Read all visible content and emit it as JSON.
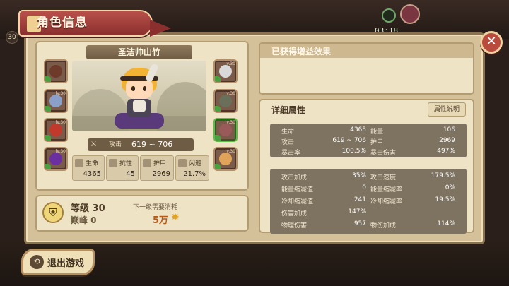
{
  "hud": {
    "level_badge": "30",
    "timer": "03:18"
  },
  "title": "角色信息",
  "close_symbol": "✕",
  "character": {
    "name": "圣洁帅山竹",
    "attack_label": "攻击",
    "attack_value": "619 ~ 706",
    "stats": [
      {
        "label": "生命",
        "value": "4365"
      },
      {
        "label": "抗性",
        "value": "45"
      },
      {
        "label": "护甲",
        "value": "2969"
      },
      {
        "label": "闪避",
        "value": "21.7%"
      }
    ]
  },
  "equipment": [
    {
      "lv": "",
      "color": "#6e3a2a"
    },
    {
      "lv": "lv.30",
      "color": "#8aa0c8"
    },
    {
      "lv": "lv.30",
      "color": "#c0392b"
    },
    {
      "lv": "lv.30",
      "color": "#6b2fa0"
    },
    {
      "lv": "lv.30",
      "color": "#d9d9d9"
    },
    {
      "lv": "lv.30",
      "color": "#6a6f5a"
    },
    {
      "lv": "lv.30",
      "color": "#9a5a5a"
    },
    {
      "lv": "lv.30",
      "color": "#e1a35a"
    }
  ],
  "level": {
    "level_text": "等级 30",
    "rank_text": "巅峰 0",
    "next_label": "下一级需要消耗",
    "cost": "5万"
  },
  "buffs": {
    "title": "已获得增益效果"
  },
  "attributes": {
    "title": "详细属性",
    "explain_button": "属性说明",
    "block1": [
      {
        "l1": "生命",
        "v1": "4365",
        "l2": "能量",
        "v2": "106"
      },
      {
        "l1": "攻击",
        "v1": "619 ~ 706",
        "l2": "护甲",
        "v2": "2969"
      },
      {
        "l1": "暴击率",
        "v1": "100.5%",
        "l2": "暴击伤害",
        "v2": "497%"
      }
    ],
    "block2": [
      {
        "l1": "攻击加成",
        "v1": "35%",
        "l2": "攻击速度",
        "v2": "179.5%"
      },
      {
        "l1": "能量缩减值",
        "v1": "0",
        "l2": "能量缩减率",
        "v2": "0%"
      },
      {
        "l1": "冷却缩减值",
        "v1": "241",
        "l2": "冷却缩减率",
        "v2": "19.5%"
      },
      {
        "l1": "伤害加成",
        "v1": "147%",
        "l2": "",
        "v2": ""
      },
      {
        "l1": "物理伤害",
        "v1": "957",
        "l2": "物伤加成",
        "v2": "114%"
      }
    ]
  },
  "exit_button": "退出游戏",
  "icons": {
    "attack": "sword-icon",
    "star": "star-icon",
    "helmet": "helmet-icon",
    "exit": "exit-icon"
  }
}
